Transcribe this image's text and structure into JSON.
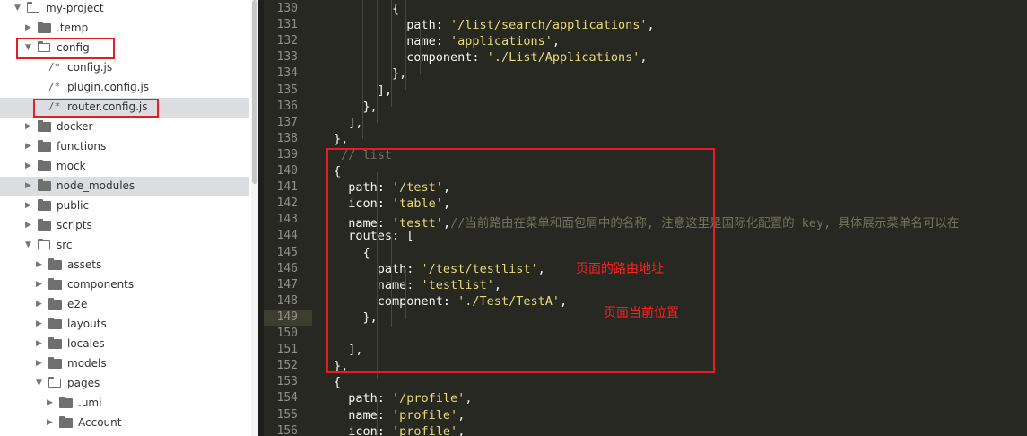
{
  "sidebar": {
    "items": [
      {
        "label": "my-project",
        "kind": "folder",
        "open": true,
        "depth": 0,
        "top": 0
      },
      {
        "label": ".temp",
        "kind": "folder",
        "open": false,
        "depth": 1
      },
      {
        "label": "config",
        "kind": "folder",
        "open": true,
        "depth": 1
      },
      {
        "label": "config.js",
        "kind": "file",
        "icon": "/*",
        "depth": 2
      },
      {
        "label": "plugin.config.js",
        "kind": "file",
        "icon": "/*",
        "depth": 2
      },
      {
        "label": "router.config.js",
        "kind": "file",
        "icon": "/*",
        "depth": 2,
        "selected": true
      },
      {
        "label": "docker",
        "kind": "folder",
        "open": false,
        "depth": 1
      },
      {
        "label": "functions",
        "kind": "folder",
        "open": false,
        "depth": 1
      },
      {
        "label": "mock",
        "kind": "folder",
        "open": false,
        "depth": 1
      },
      {
        "label": "node_modules",
        "kind": "folder",
        "open": false,
        "depth": 1,
        "selected": true
      },
      {
        "label": "public",
        "kind": "folder",
        "open": false,
        "depth": 1
      },
      {
        "label": "scripts",
        "kind": "folder",
        "open": false,
        "depth": 1
      },
      {
        "label": "src",
        "kind": "folder",
        "open": true,
        "depth": 1
      },
      {
        "label": "assets",
        "kind": "folder",
        "open": false,
        "depth": 2
      },
      {
        "label": "components",
        "kind": "folder",
        "open": false,
        "depth": 2
      },
      {
        "label": "e2e",
        "kind": "folder",
        "open": false,
        "depth": 2
      },
      {
        "label": "layouts",
        "kind": "folder",
        "open": false,
        "depth": 2
      },
      {
        "label": "locales",
        "kind": "folder",
        "open": false,
        "depth": 2
      },
      {
        "label": "models",
        "kind": "folder",
        "open": false,
        "depth": 2
      },
      {
        "label": "pages",
        "kind": "folder",
        "open": true,
        "depth": 2
      },
      {
        "label": ".umi",
        "kind": "folder",
        "open": false,
        "depth": 3
      },
      {
        "label": "Account",
        "kind": "folder",
        "open": false,
        "depth": 3
      }
    ]
  },
  "editor": {
    "current_line": 149,
    "lines": [
      {
        "n": 130,
        "tokens": [
          [
            "p",
            "        {"
          ]
        ]
      },
      {
        "n": 131,
        "tokens": [
          [
            "k",
            "          path: "
          ],
          [
            "s",
            "'/list/search/applications'"
          ],
          [
            "p",
            ","
          ]
        ]
      },
      {
        "n": 132,
        "tokens": [
          [
            "k",
            "          name: "
          ],
          [
            "s",
            "'applications'"
          ],
          [
            "p",
            ","
          ]
        ]
      },
      {
        "n": 133,
        "tokens": [
          [
            "k",
            "          component: "
          ],
          [
            "s",
            "'./List/Applications'"
          ],
          [
            "p",
            ","
          ]
        ]
      },
      {
        "n": 134,
        "tokens": [
          [
            "p",
            "        },"
          ]
        ]
      },
      {
        "n": 135,
        "tokens": [
          [
            "p",
            "      ],"
          ]
        ]
      },
      {
        "n": 136,
        "tokens": [
          [
            "p",
            "    },"
          ]
        ]
      },
      {
        "n": 137,
        "tokens": [
          [
            "p",
            "  ],"
          ]
        ]
      },
      {
        "n": 138,
        "tokens": [
          [
            "p",
            "},"
          ]
        ]
      },
      {
        "n": 139,
        "tokens": [
          [
            "c",
            " // list"
          ]
        ]
      },
      {
        "n": 140,
        "tokens": [
          [
            "p",
            "{"
          ]
        ]
      },
      {
        "n": 141,
        "tokens": [
          [
            "k",
            "  path: "
          ],
          [
            "s",
            "'/test'"
          ],
          [
            "p",
            ","
          ]
        ]
      },
      {
        "n": 142,
        "tokens": [
          [
            "k",
            "  icon: "
          ],
          [
            "s",
            "'table'"
          ],
          [
            "p",
            ","
          ]
        ]
      },
      {
        "n": 143,
        "tokens": [
          [
            "k",
            "  name: "
          ],
          [
            "s",
            "'testt'"
          ],
          [
            "p",
            ","
          ],
          [
            "c",
            "//当前路由在菜单和面包屑中的名称, 注意这里是国际化配置的 key, 具体展示菜单名可以在"
          ]
        ]
      },
      {
        "n": 144,
        "tokens": [
          [
            "k",
            "  routes: "
          ],
          [
            "p",
            "["
          ]
        ]
      },
      {
        "n": 145,
        "tokens": [
          [
            "p",
            "    {"
          ]
        ]
      },
      {
        "n": 146,
        "tokens": [
          [
            "k",
            "      path: "
          ],
          [
            "s",
            "'/test/testlist'"
          ],
          [
            "p",
            ","
          ]
        ]
      },
      {
        "n": 147,
        "tokens": [
          [
            "k",
            "      name: "
          ],
          [
            "s",
            "'testlist'"
          ],
          [
            "p",
            ","
          ]
        ]
      },
      {
        "n": 148,
        "tokens": [
          [
            "k",
            "      component: "
          ],
          [
            "s",
            "'./Test/TestA'"
          ],
          [
            "p",
            ","
          ]
        ]
      },
      {
        "n": 149,
        "tokens": [
          [
            "p",
            "    },"
          ]
        ]
      },
      {
        "n": 150,
        "tokens": []
      },
      {
        "n": 151,
        "tokens": [
          [
            "p",
            "  ],"
          ]
        ]
      },
      {
        "n": 152,
        "tokens": [
          [
            "p",
            "},"
          ]
        ]
      },
      {
        "n": 153,
        "tokens": [
          [
            "p",
            "{"
          ]
        ]
      },
      {
        "n": 154,
        "tokens": [
          [
            "k",
            "  path: "
          ],
          [
            "s",
            "'/profile'"
          ],
          [
            "p",
            ","
          ]
        ]
      },
      {
        "n": 155,
        "tokens": [
          [
            "k",
            "  name: "
          ],
          [
            "s",
            "'profile'"
          ],
          [
            "p",
            ","
          ]
        ]
      },
      {
        "n": 156,
        "tokens": [
          [
            "k",
            "  icon: "
          ],
          [
            "s",
            "'profile'"
          ],
          [
            "p",
            ","
          ]
        ]
      }
    ]
  },
  "annotations": {
    "route_address": "页面的路由地址",
    "page_position": "页面当前位置"
  },
  "colors": {
    "highlight_box": "#e51c23",
    "annotation_text": "#ff2020"
  }
}
